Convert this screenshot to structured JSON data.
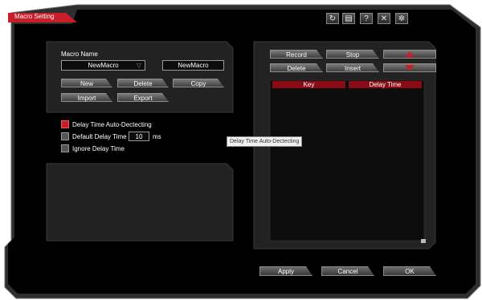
{
  "window": {
    "title": "Macro Setting",
    "controls": [
      "refresh",
      "save",
      "help",
      "close",
      "tools"
    ],
    "accent": "#c81d2a",
    "background": "#000000"
  },
  "macro_panel": {
    "name_label": "Macro Name",
    "selected_macro": "NewMacro",
    "name_input_value": "NewMacro",
    "buttons": {
      "new": "New",
      "delete": "Delete",
      "copy": "Copy",
      "import": "Import",
      "export": "Export"
    }
  },
  "options": {
    "delay_auto": {
      "label": "Delay Time Auto-Dectecting",
      "checked": true
    },
    "default_delay": {
      "label": "Default Delay Time",
      "checked": false,
      "value": "10",
      "unit": "ms"
    },
    "ignore_delay": {
      "label": "Ignore Delay Time",
      "checked": false
    }
  },
  "tooltip": "Delay Time Auto-Dectecting",
  "record_panel": {
    "buttons": {
      "record": "Record",
      "stop": "Stop",
      "delete": "Delete",
      "insert": "Insert"
    },
    "table_headers": {
      "key": "Key",
      "delay_time": "Delay Time"
    },
    "rows": []
  },
  "footer": {
    "apply": "Apply",
    "cancel": "Cancel",
    "ok": "OK"
  }
}
